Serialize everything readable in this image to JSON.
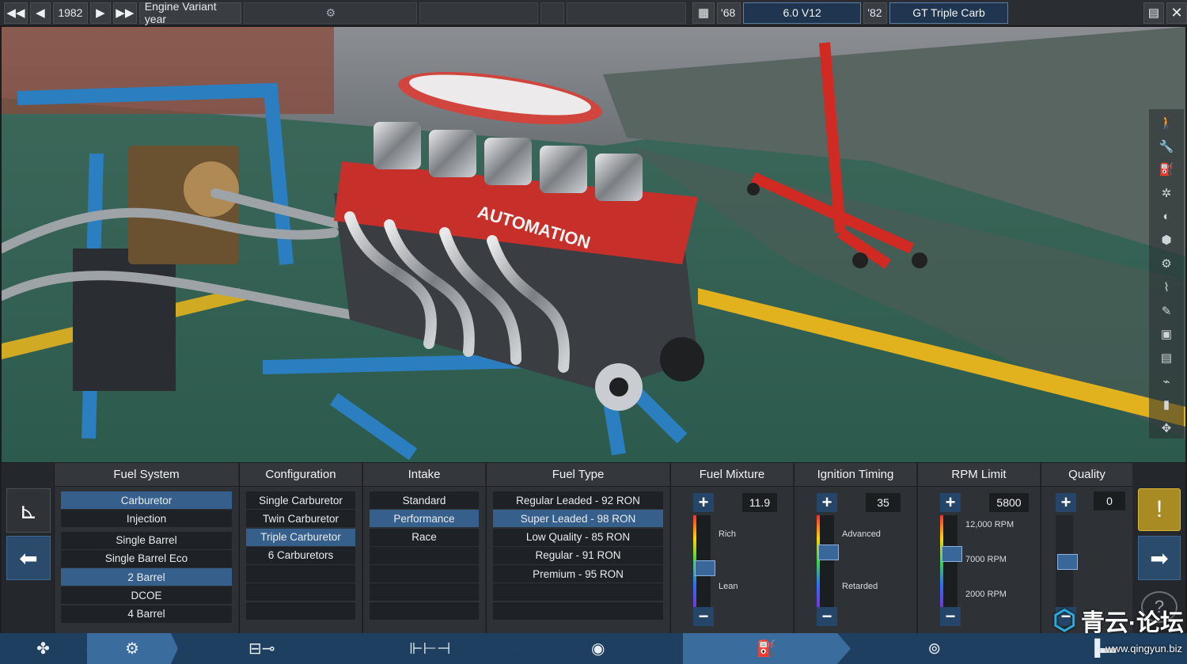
{
  "topbar": {
    "year_prev_icon": "double-left-arrow",
    "year_back_icon": "left-arrow",
    "year": "1982",
    "year_fwd_icon": "right-arrow",
    "year_next_icon": "double-right-arrow",
    "variant_label": "Engine Variant year",
    "engine_icon": "engine-icon",
    "family_icon": "engine-block-icon",
    "family_year": "'68",
    "family_name": "6.0 V12",
    "variant_year": "'82",
    "variant_name": "GT Triple Carb",
    "save_icon": "save-icon",
    "close_icon": "close-icon"
  },
  "tools": [
    "walk-icon",
    "wrench-icon",
    "piston-icon",
    "fan-icon",
    "turbo-icon",
    "block-icon",
    "gear-icon",
    "exhaust-icon",
    "ruler-icon",
    "box-icon",
    "box-icon",
    "pipe-icon",
    "boot-icon",
    "move-icon"
  ],
  "panel": {
    "fuel_system": {
      "title": "Fuel System",
      "types": [
        "Carburetor",
        "Injection"
      ],
      "selected_type": "Carburetor",
      "barrels": [
        "Single Barrel",
        "Single Barrel Eco",
        "2 Barrel",
        "DCOE",
        "4 Barrel"
      ],
      "selected_barrel": "2 Barrel"
    },
    "configuration": {
      "title": "Configuration",
      "options": [
        "Single Carburetor",
        "Twin Carburetor",
        "Triple Carburetor",
        "6 Carburetors"
      ],
      "selected": "Triple Carburetor"
    },
    "intake": {
      "title": "Intake",
      "options": [
        "Standard",
        "Performance",
        "Race"
      ],
      "selected": "Performance"
    },
    "fuel_type": {
      "title": "Fuel Type",
      "options": [
        "Regular Leaded -  92 RON",
        "Super Leaded -  98 RON",
        "Low Quality - 85 RON",
        "Regular - 91 RON",
        "Premium - 95 RON"
      ],
      "selected": "Super Leaded -  98 RON"
    },
    "fuel_mixture": {
      "title": "Fuel Mixture",
      "value": "11.9",
      "top_label": "Rich",
      "bottom_label": "Lean",
      "level": 0.58
    },
    "ignition_timing": {
      "title": "Ignition Timing",
      "value": "35",
      "top_label": "Advanced",
      "bottom_label": "Retarded",
      "level": 0.38
    },
    "rpm_limit": {
      "title": "RPM Limit",
      "value": "5800",
      "labels": [
        "12,000 RPM",
        "7000 RPM",
        "2000 RPM"
      ],
      "level": 0.4
    },
    "quality": {
      "title": "Quality",
      "value": "0",
      "level": 0.5
    },
    "plus": "+",
    "minus": "−",
    "warning_icon": "!",
    "help_icon": "?"
  },
  "nav": [
    "engine-family-icon",
    "engine-variant-icon",
    "bottom-end-icon",
    "top-end-icon",
    "aspiration-icon",
    "fuel-icon",
    "exhaust-icon",
    "test-icon"
  ],
  "watermark": {
    "text": "青云·论坛",
    "url": "www.qingyun.biz"
  }
}
